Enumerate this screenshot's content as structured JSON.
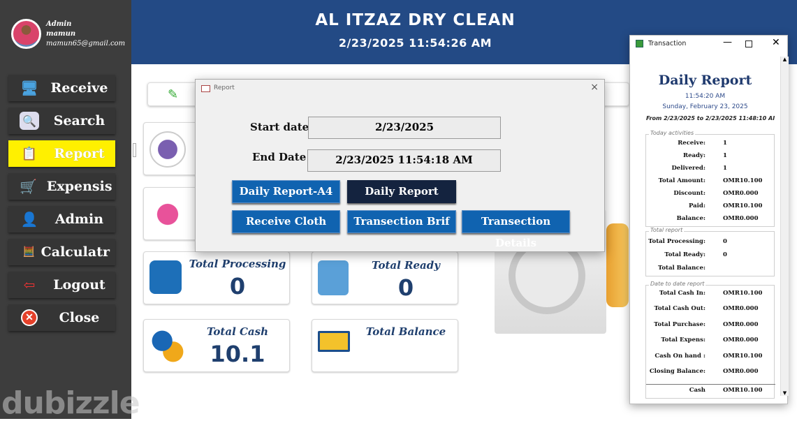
{
  "user": {
    "role": "Admin",
    "name": "mamun",
    "email": "mamun65@gmail.com"
  },
  "sidebar": {
    "items": [
      {
        "label": "Receive",
        "icon": "monitor-icon"
      },
      {
        "label": "Search",
        "icon": "search-icon"
      },
      {
        "label": "Report",
        "icon": "clipboard-icon",
        "active": true
      },
      {
        "label": "Expensis",
        "icon": "cart-icon"
      },
      {
        "label": "Admin",
        "icon": "user-icon"
      },
      {
        "label": "Calculatr",
        "icon": "calculator-icon"
      },
      {
        "label": "Logout",
        "icon": "logout-door-icon"
      },
      {
        "label": "Close",
        "icon": "close-icon"
      }
    ]
  },
  "header": {
    "title": "AL ITZAZ DRY CLEAN",
    "datetime": "2/23/2025 11:54:26 AM"
  },
  "cards": [
    {
      "title": "Total Processing",
      "value": "0"
    },
    {
      "title": "Total Ready",
      "value": "0"
    },
    {
      "title": "Total Cash",
      "value": "10.1"
    },
    {
      "title": "Total Balance",
      "value": ""
    }
  ],
  "dialog": {
    "title": "Report",
    "start_label": "Start date",
    "start_value": "2/23/2025",
    "end_label": "End Date",
    "end_value": "2/23/2025 11:54:18 AM",
    "buttons": [
      "Daily Report-A4",
      "Daily Report",
      "Receive Cloth",
      "Transection Brif",
      "Transection Details"
    ]
  },
  "transaction": {
    "window_title": "Transaction",
    "report_title": "Daily Report",
    "time": "11:54:20 AM",
    "date": "Sunday, February 23, 2025",
    "range": "From 2/23/2025  to  2/23/2025 11:48:10 AI",
    "today": {
      "label": "Today activities",
      "rows": [
        [
          "Receive:",
          "1"
        ],
        [
          "Ready:",
          "1"
        ],
        [
          "Delivered:",
          "1"
        ],
        [
          "Total Amount:",
          "OMR10.100"
        ],
        [
          "Discount:",
          "OMR0.000"
        ],
        [
          "Paid:",
          "OMR10.100"
        ],
        [
          "Balance:",
          "OMR0.000"
        ]
      ]
    },
    "total": {
      "label": "Total report",
      "rows": [
        [
          "Total Processing:",
          "0"
        ],
        [
          "Total Ready:",
          "0"
        ],
        [
          "Total Balance:",
          ""
        ]
      ]
    },
    "date_to_date": {
      "label": "Date to date report",
      "rows": [
        [
          "Total Cash In:",
          "OMR10.100"
        ],
        [
          "Total Cash Out:",
          "OMR0.000"
        ],
        [
          "Total Purchase:",
          "OMR0.000"
        ],
        [
          "Total Expens:",
          "OMR0.000"
        ],
        [
          "Cash On hand :",
          "OMR10.100"
        ],
        [
          "Closing Balance:",
          "OMR0.000"
        ]
      ]
    },
    "cash": [
      "Cash",
      "OMR10.100"
    ]
  },
  "watermark": "dubizzle"
}
